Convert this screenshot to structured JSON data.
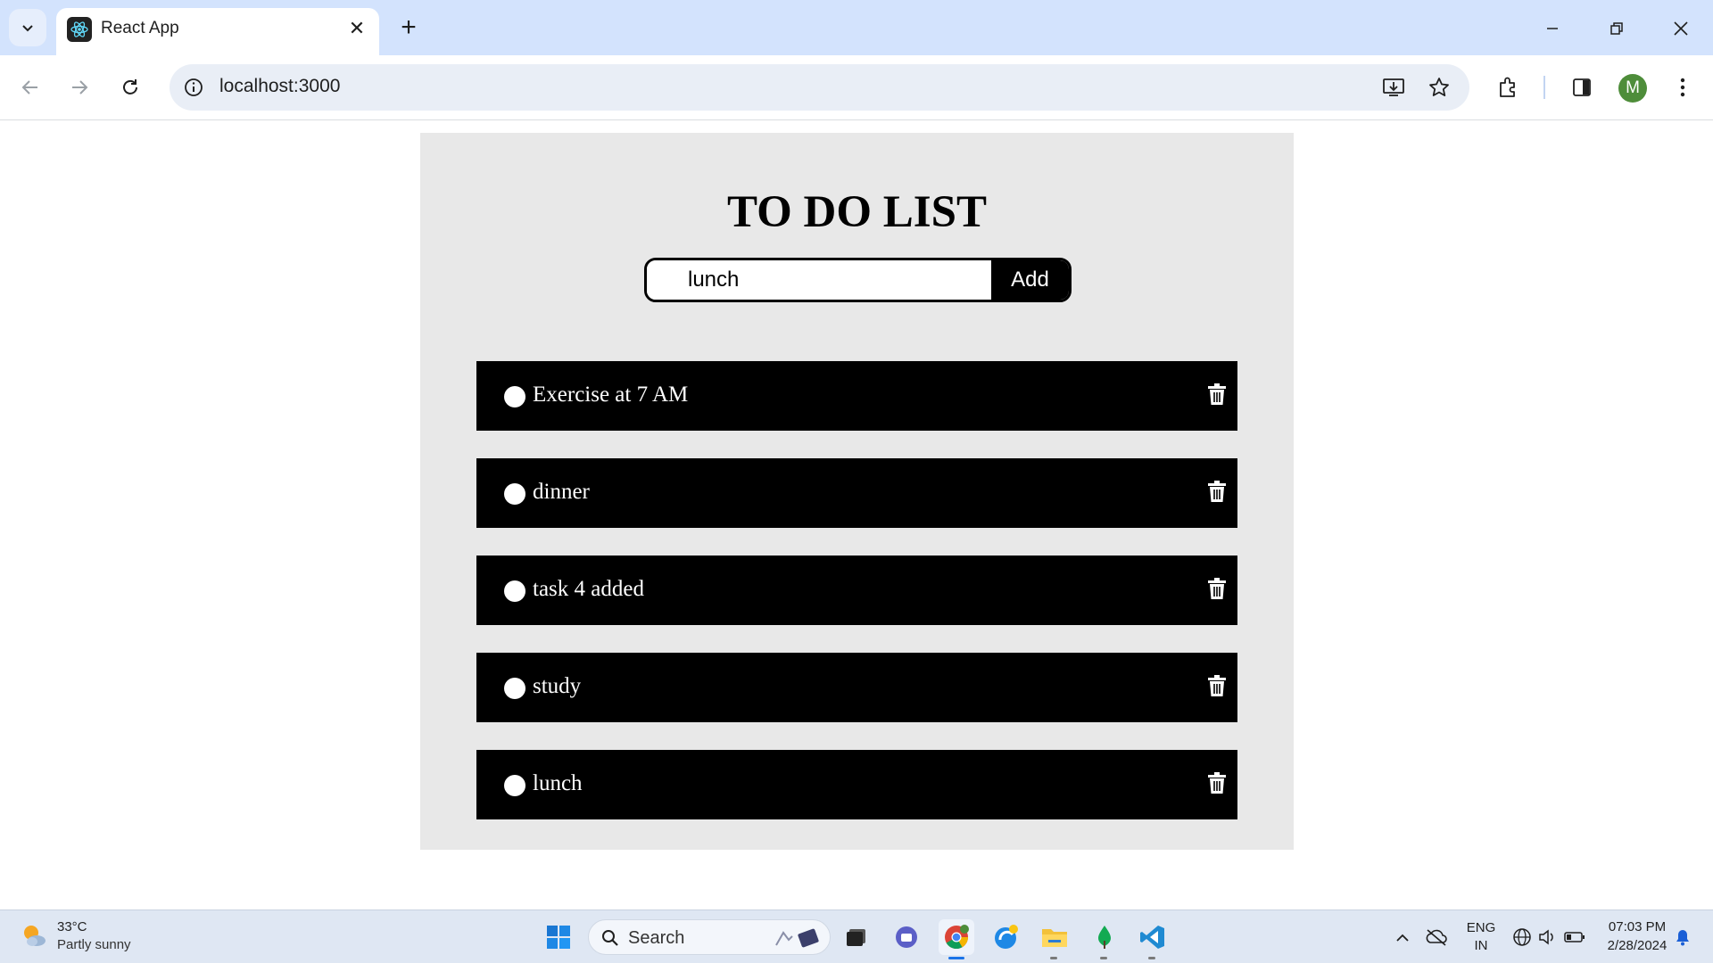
{
  "browser": {
    "tab_title": "React App",
    "url": "localhost:3000",
    "profile_initial": "M"
  },
  "app": {
    "heading": "TO DO LIST",
    "input_value": "lunch",
    "add_label": "Add",
    "todos": [
      {
        "text": "Exercise at 7 AM"
      },
      {
        "text": "dinner"
      },
      {
        "text": "task 4 added"
      },
      {
        "text": "study"
      },
      {
        "text": "lunch"
      }
    ]
  },
  "taskbar": {
    "temperature": "33°C",
    "weather": "Partly sunny",
    "search_label": "Search",
    "lang_top": "ENG",
    "lang_bottom": "IN",
    "time": "07:03 PM",
    "date": "2/28/2024"
  },
  "colors": {
    "tabstrip": "#d3e3fd",
    "card": "#e8e8e8",
    "todo_bg": "#000000",
    "todo_text": "#ffffff"
  }
}
